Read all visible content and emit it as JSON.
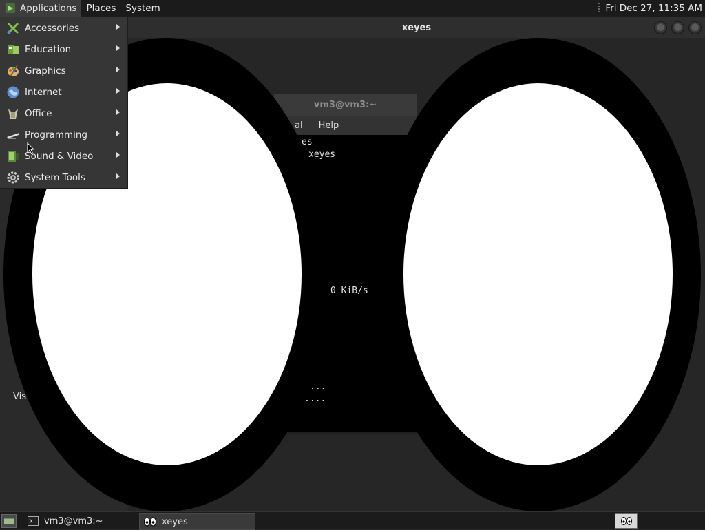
{
  "top_panel": {
    "menus": [
      "Applications",
      "Places",
      "System"
    ],
    "clock": "Fri Dec 27, 11:35 AM"
  },
  "applications_menu": {
    "items": [
      {
        "label": "Accessories",
        "icon": "accessories-icon"
      },
      {
        "label": "Education",
        "icon": "education-icon"
      },
      {
        "label": "Graphics",
        "icon": "graphics-icon"
      },
      {
        "label": "Internet",
        "icon": "internet-icon"
      },
      {
        "label": "Office",
        "icon": "office-icon"
      },
      {
        "label": "Programming",
        "icon": "programming-icon"
      },
      {
        "label": "Sound & Video",
        "icon": "sound-video-icon"
      },
      {
        "label": "System Tools",
        "icon": "system-tools-icon"
      }
    ]
  },
  "xeyes_window": {
    "title": "xeyes"
  },
  "terminal": {
    "title": "vm3@vm3:~",
    "menu_partial": "al",
    "menu_help": "Help",
    "lines": [
      "es",
      "xeyes",
      "0 KiB/s",
      "...",
      "...."
    ]
  },
  "desktop": {
    "partial_label": "Vis"
  },
  "taskbar": {
    "tasks": [
      {
        "label": "vm3@vm3:~",
        "icon": "terminal-icon"
      },
      {
        "label": "xeyes",
        "icon": "xeyes-icon"
      }
    ]
  },
  "colors": {
    "panel_bg": "#1b1b1b",
    "menu_bg": "#363636",
    "active_highlight": "#3d3d3d"
  }
}
